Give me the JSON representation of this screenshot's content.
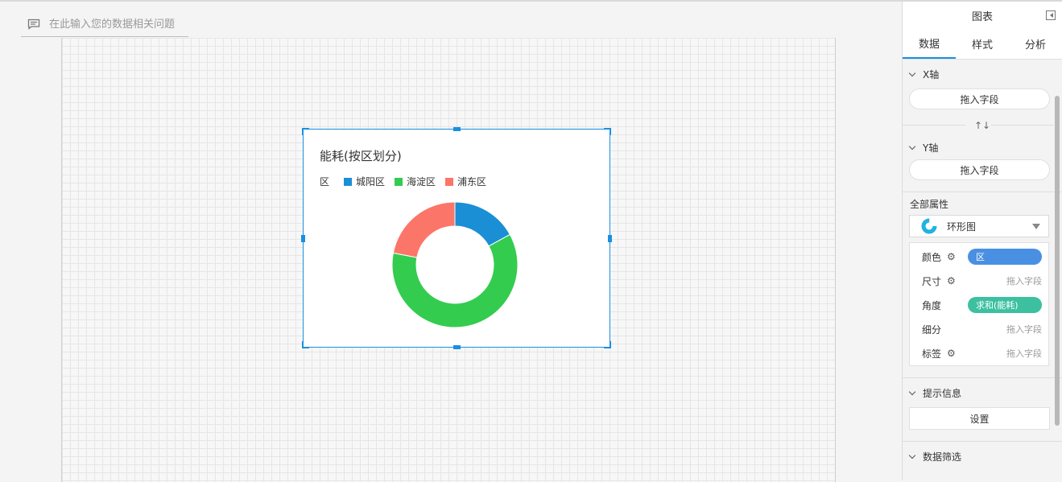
{
  "ask_bar": {
    "placeholder": "在此输入您的数据相关问题",
    "icon": "chat-icon"
  },
  "chart_widget": {
    "title": "能耗(按区划分)",
    "legend_field": "区"
  },
  "chart_data": {
    "type": "pie",
    "title": "能耗(按区划分)",
    "donut": true,
    "legend_title": "区",
    "legend_position": "top-left",
    "categories": [
      "城阳区",
      "海淀区",
      "浦东区"
    ],
    "values": [
      17,
      61,
      22
    ],
    "colors": [
      "#1a8fd6",
      "#33cc4f",
      "#fb7668"
    ]
  },
  "panel": {
    "title": "图表",
    "tabs": [
      "数据",
      "样式",
      "分析"
    ],
    "active_tab": "数据",
    "x_axis": {
      "label": "X轴",
      "placeholder": "拖入字段"
    },
    "swap_icon": "↑↓",
    "y_axis": {
      "label": "Y轴",
      "placeholder": "拖入字段"
    },
    "all_props": {
      "title": "全部属性",
      "chart_type": "环形图",
      "rows": [
        {
          "label": "颜色",
          "value": "区",
          "kind": "pill-blue"
        },
        {
          "label": "尺寸",
          "value": "拖入字段",
          "kind": "empty"
        },
        {
          "label": "角度",
          "value": "求和(能耗)",
          "kind": "pill-teal"
        },
        {
          "label": "细分",
          "value": "拖入字段",
          "kind": "empty"
        },
        {
          "label": "标签",
          "value": "拖入字段",
          "kind": "empty"
        }
      ]
    },
    "tooltip": {
      "label": "提示信息",
      "button": "设置"
    },
    "filter": {
      "label": "数据筛选"
    }
  }
}
